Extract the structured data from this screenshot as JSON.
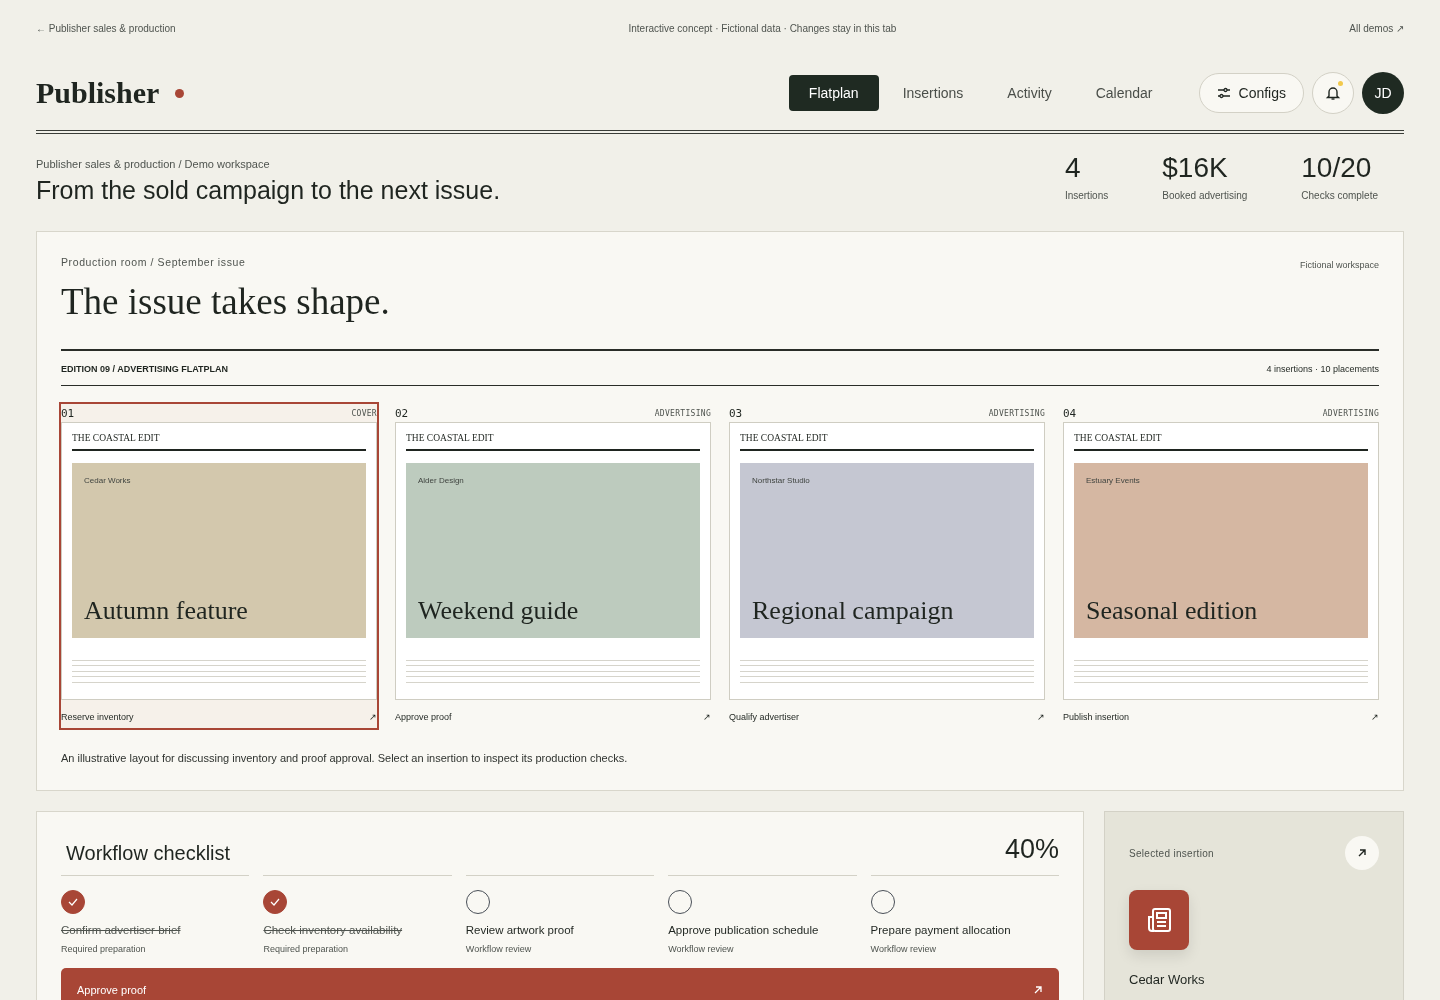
{
  "topbar": {
    "back_link": "← Publisher sales & production",
    "notice": "Interactive concept · Fictional data · Changes stay in this tab",
    "demos_link": "All demos ↗"
  },
  "header": {
    "brand": "Publisher",
    "nav": [
      {
        "label": "Flatplan",
        "selected": true
      },
      {
        "label": "Insertions",
        "selected": false
      },
      {
        "label": "Activity",
        "selected": false
      },
      {
        "label": "Calendar",
        "selected": false
      }
    ],
    "configs_button": "Configs",
    "notifications_unread": true,
    "avatar": "JD"
  },
  "intro": {
    "breadcrumb": "Publisher sales & production / Demo workspace",
    "headline": "From the sold campaign to the next issue.",
    "stats": [
      {
        "value": "4",
        "label": "Insertions"
      },
      {
        "value": "$16K",
        "label": "Booked advertising"
      },
      {
        "value": "10/20",
        "label": "Checks complete"
      }
    ]
  },
  "flatplan": {
    "eyebrow": "Production room / September issue",
    "title": "The issue takes shape.",
    "tag": "Fictional workspace",
    "edition": "EDITION 09 / ADVERTISING FLATPLAN",
    "summary": "4 insertions · 10 placements",
    "slots": [
      {
        "number": "01",
        "type": "COVER",
        "masthead": "THE COASTAL EDIT",
        "advertiser": "Cedar Works",
        "title": "Autumn feature",
        "color": "#d3c8ad",
        "action": "Reserve inventory",
        "arrow": "↗",
        "selected": true
      },
      {
        "number": "02",
        "type": "ADVERTISING",
        "masthead": "THE COASTAL EDIT",
        "advertiser": "Alder Design",
        "title": "Weekend guide",
        "color": "#bdcbbe",
        "action": "Approve proof",
        "arrow": "↗",
        "selected": false
      },
      {
        "number": "03",
        "type": "ADVERTISING",
        "masthead": "THE COASTAL EDIT",
        "advertiser": "Northstar Studio",
        "title": "Regional campaign",
        "color": "#c5c7d2",
        "action": "Qualify advertiser",
        "arrow": "↗",
        "selected": false
      },
      {
        "number": "04",
        "type": "ADVERTISING",
        "masthead": "THE COASTAL EDIT",
        "advertiser": "Estuary Events",
        "title": "Seasonal edition",
        "color": "#d5b7a2",
        "action": "Publish insertion",
        "arrow": "↗",
        "selected": false
      }
    ],
    "caption": "An illustrative layout for discussing inventory and proof approval. Select an insertion to inspect its production checks."
  },
  "checklist": {
    "title": "Workflow checklist",
    "percent": "40%",
    "items": [
      {
        "label": "Confirm advertiser brief",
        "sub": "Required preparation",
        "checked": true
      },
      {
        "label": "Check inventory availability",
        "sub": "Required preparation",
        "checked": true
      },
      {
        "label": "Review artwork proof",
        "sub": "Workflow review",
        "checked": false
      },
      {
        "label": "Approve publication schedule",
        "sub": "Workflow review",
        "checked": false
      },
      {
        "label": "Prepare payment allocation",
        "sub": "Workflow review",
        "checked": false
      }
    ],
    "primary_button": "Approve proof"
  },
  "selected_insertion": {
    "label": "Selected insertion",
    "advertiser": "Cedar Works"
  }
}
